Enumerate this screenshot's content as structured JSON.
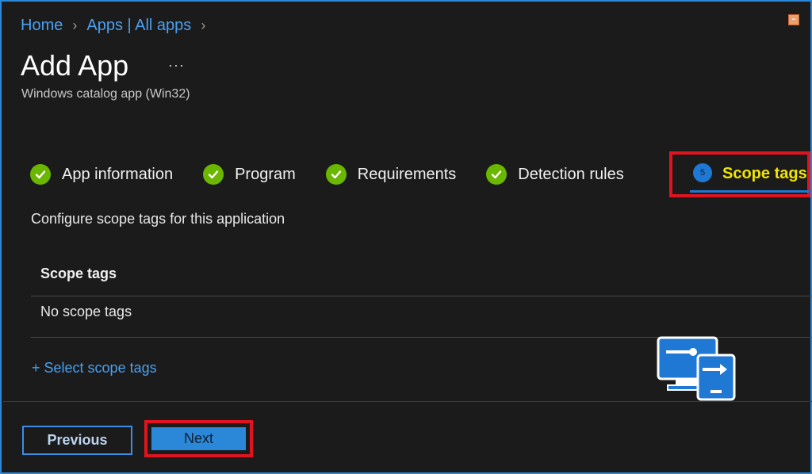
{
  "breadcrumb": {
    "items": [
      "Home",
      "Apps | All apps"
    ],
    "separator_icon": "chevron-right-icon"
  },
  "header": {
    "title": "Add App",
    "more_label": "···",
    "subtitle": "Windows catalog app (Win32)"
  },
  "wizard": {
    "steps": [
      {
        "label": "App information",
        "status": "complete"
      },
      {
        "label": "Program",
        "status": "complete"
      },
      {
        "label": "Requirements",
        "status": "complete"
      },
      {
        "label": "Detection rules",
        "status": "complete"
      }
    ],
    "active_step": {
      "number": "5",
      "label": "Scope tags"
    }
  },
  "main": {
    "description": "Configure scope tags for this application",
    "table": {
      "header": "Scope tags",
      "rows": [
        "No scope tags"
      ]
    },
    "select_link": "+ Select scope tags"
  },
  "footer": {
    "previous_label": "Previous",
    "next_label": "Next"
  },
  "colors": {
    "accent": "#2b88d8",
    "check": "#6bb700",
    "highlight": "#e0141e",
    "active_text": "#f2e600"
  }
}
